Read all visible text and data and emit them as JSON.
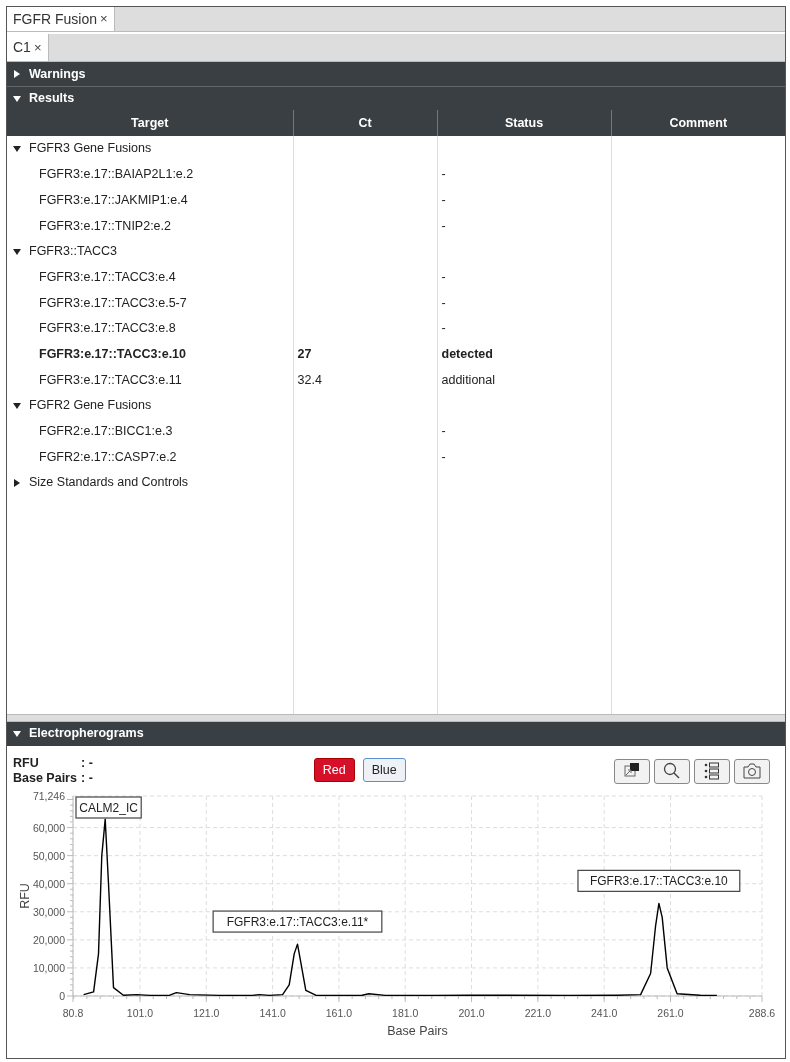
{
  "tabs": [
    {
      "label": "FGFR Fusion",
      "close": "×",
      "selected": true
    }
  ],
  "subtabs": [
    {
      "label": "C1",
      "close": "×",
      "selected": true
    }
  ],
  "sections": [
    {
      "title": "Warnings",
      "expanded": false
    },
    {
      "title": "Results",
      "expanded": true
    }
  ],
  "table": {
    "columns": [
      "Target",
      "Ct",
      "Status",
      "Comment"
    ],
    "groups": [
      {
        "label": "FGFR3 Gene Fusions",
        "expanded": true,
        "children": [
          {
            "target": "FGFR3:e.17::BAIAP2L1:e.2",
            "status": "-",
            "highlighted": false
          },
          {
            "target": "FGFR3:e.17::JAKMIP1:e.4",
            "status": "-",
            "highlighted": false
          },
          {
            "target": "FGFR3:e.17::TNIP2:e.2",
            "status": "-",
            "highlighted": false
          }
        ]
      },
      {
        "label": "FGFR3::TACC3",
        "expanded": true,
        "children": [
          {
            "target": "FGFR3:e.17::TACC3:e.4",
            "status": "-",
            "highlighted": false
          },
          {
            "target": "FGFR3:e.17::TACC3:e.5-7",
            "status": "-",
            "highlighted": false
          },
          {
            "target": "FGFR3:e.17::TACC3:e.8",
            "status": "-",
            "highlighted": false
          },
          {
            "target": "FGFR3:e.17::TACC3:e.10",
            "ct": "27",
            "status": "detected",
            "highlighted": true
          },
          {
            "target": "FGFR3:e.17::TACC3:e.11",
            "ct": "32.4",
            "status": "additional",
            "highlighted": false
          }
        ]
      },
      {
        "label": "FGFR2 Gene Fusions",
        "expanded": true,
        "children": [
          {
            "target": "FGFR2:e.17::BICC1:e.3",
            "status": "-",
            "highlighted": false
          },
          {
            "target": "FGFR2:e.17::CASP7:e.2",
            "status": "-",
            "highlighted": false
          }
        ]
      },
      {
        "label": "Size Standards and Controls",
        "expanded": false
      }
    ]
  },
  "electropherograms": {
    "title": "Electropherograms",
    "expanded": true,
    "readouts": [
      {
        "label": "RFU",
        "value": ": -"
      },
      {
        "label": "Base Pairs",
        "value": ": -"
      }
    ],
    "channels": [
      {
        "label": "Red",
        "selected": true
      },
      {
        "label": "Blue",
        "selected": false
      }
    ],
    "chart_data": {
      "type": "line",
      "grid": true,
      "xlabel": "Base Pairs",
      "ylabel": "RFU",
      "xlim": [
        80.8,
        288.6
      ],
      "ylim": [
        0,
        71246
      ],
      "xticks": [
        {
          "value": 80.8,
          "label": "80.8"
        },
        {
          "value": 101,
          "label": "101.0"
        },
        {
          "value": 121,
          "label": "121.0"
        },
        {
          "value": 141,
          "label": "141.0"
        },
        {
          "value": 161,
          "label": "161.0"
        },
        {
          "value": 181,
          "label": "181.0"
        },
        {
          "value": 201,
          "label": "201.0"
        },
        {
          "value": 221,
          "label": "221.0"
        },
        {
          "value": 241,
          "label": "241.0"
        },
        {
          "value": 261,
          "label": "261.0"
        },
        {
          "value": 288.6,
          "label": "288.6"
        }
      ],
      "yticks": [
        {
          "value": 0,
          "label": "0"
        },
        {
          "value": 10000,
          "label": "10,000"
        },
        {
          "value": 20000,
          "label": "20,000"
        },
        {
          "value": 30000,
          "label": "30,000"
        },
        {
          "value": 40000,
          "label": "40,000"
        },
        {
          "value": 50000,
          "label": "50,000"
        },
        {
          "value": 60000,
          "label": "60,000"
        },
        {
          "value": 71246,
          "label": "71,246"
        }
      ],
      "x": [
        84,
        87,
        88.5,
        89.5,
        90.5,
        91.5,
        93,
        96,
        100,
        104,
        110,
        112,
        116,
        125,
        135,
        137,
        140,
        144,
        146,
        147.5,
        148.5,
        149.5,
        151,
        154,
        160,
        168,
        170,
        175,
        190,
        200,
        230,
        245,
        252,
        255,
        256.5,
        257.5,
        258.5,
        260,
        263,
        270,
        275
      ],
      "series": [
        {
          "color": "#000000",
          "values": [
            500,
            1500,
            15000,
            50000,
            63000,
            40000,
            3000,
            300,
            500,
            200,
            300,
            1200,
            500,
            200,
            200,
            500,
            200,
            500,
            4000,
            15000,
            18500,
            12000,
            2000,
            300,
            200,
            300,
            800,
            200,
            200,
            300,
            200,
            300,
            500,
            8000,
            25000,
            33000,
            28000,
            10000,
            800,
            300,
            200
          ]
        }
      ],
      "annotations": [
        "CALM2_IC",
        "FGFR3:e.17::TACC3:e.11*",
        "FGFR3:e.17::TACC3:e.10"
      ]
    }
  }
}
